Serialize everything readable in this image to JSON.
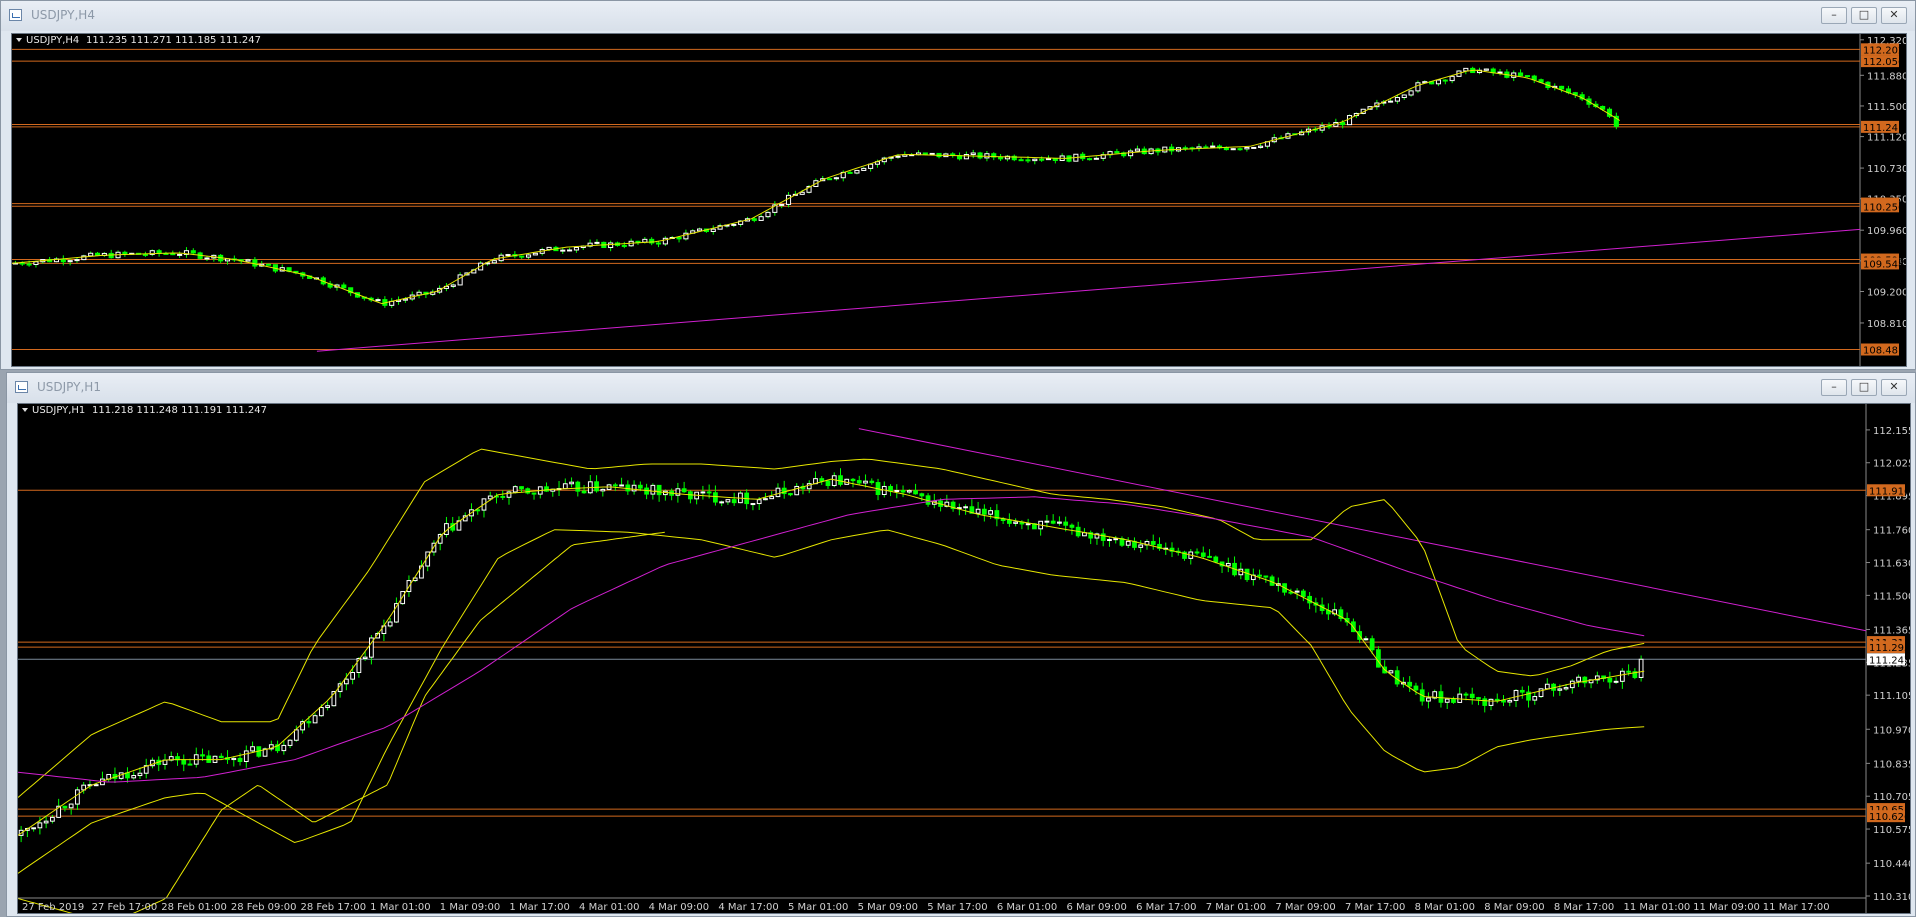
{
  "windows": [
    {
      "id": "top",
      "title": "USDJPY,H4",
      "symbol_label": "USDJPY,H4",
      "ohlc_label": "111.235 111.271 111.185 111.247",
      "buttons": [
        "–",
        "□",
        "✕"
      ],
      "chart_data": {
        "type": "candlestick",
        "price_axis": {
          "range": [
            108.45,
            112.33
          ],
          "ticks": [
            "112.320",
            "111.880",
            "111.500",
            "111.120",
            "110.730",
            "110.350",
            "109.960",
            "109.580",
            "109.200",
            "108.810"
          ],
          "tick_values": [
            112.32,
            111.88,
            111.5,
            111.12,
            110.73,
            110.35,
            109.96,
            109.58,
            109.2,
            108.81
          ]
        },
        "price_labels": [
          {
            "text": "112.202",
            "value": 112.202
          },
          {
            "text": "112.056",
            "value": 112.056
          },
          {
            "text": "111.241",
            "value": 111.241
          },
          {
            "text": "110.290",
            "value": 110.29
          },
          {
            "text": "110.256",
            "value": 110.256
          },
          {
            "text": "109.596",
            "value": 109.596
          },
          {
            "text": "109.548",
            "value": 109.548
          },
          {
            "text": "108.481",
            "value": 108.481
          }
        ],
        "horizontal_lines": [
          112.202,
          112.056,
          111.27,
          111.241,
          110.29,
          110.256,
          109.596,
          109.548,
          108.481
        ],
        "trendline": {
          "from": [
            0.165,
            108.46
          ],
          "to": [
            1.0,
            109.97
          ]
        },
        "series_path": [
          [
            0.0,
            109.55
          ],
          [
            0.05,
            109.65
          ],
          [
            0.09,
            109.68
          ],
          [
            0.12,
            109.6
          ],
          [
            0.16,
            109.4
          ],
          [
            0.2,
            109.05
          ],
          [
            0.23,
            109.2
          ],
          [
            0.26,
            109.6
          ],
          [
            0.3,
            109.75
          ],
          [
            0.35,
            109.82
          ],
          [
            0.4,
            110.1
          ],
          [
            0.44,
            110.6
          ],
          [
            0.48,
            110.9
          ],
          [
            0.52,
            110.88
          ],
          [
            0.57,
            110.85
          ],
          [
            0.62,
            110.95
          ],
          [
            0.67,
            111.0
          ],
          [
            0.72,
            111.3
          ],
          [
            0.76,
            111.75
          ],
          [
            0.79,
            111.95
          ],
          [
            0.82,
            111.85
          ],
          [
            0.85,
            111.6
          ],
          [
            0.87,
            111.32
          ]
        ],
        "last_price": 111.247
      }
    },
    {
      "id": "bottom",
      "title": "USDJPY,H1",
      "symbol_label": "USDJPY,H1",
      "ohlc_label": "111.218 111.248 111.191 111.247",
      "buttons": [
        "–",
        "□",
        "✕"
      ],
      "chart_data": {
        "type": "candlestick",
        "price_axis": {
          "range": [
            110.31,
            112.21
          ],
          "ticks": [
            "112.155",
            "112.025",
            "111.895",
            "111.760",
            "111.630",
            "111.500",
            "111.365",
            "111.235",
            "111.105",
            "110.970",
            "110.835",
            "110.705",
            "110.575",
            "110.440",
            "110.310"
          ],
          "tick_values": [
            112.155,
            112.025,
            111.895,
            111.76,
            111.63,
            111.5,
            111.365,
            111.235,
            111.105,
            110.97,
            110.835,
            110.705,
            110.575,
            110.44,
            110.31
          ]
        },
        "price_labels": [
          {
            "text": "111.916",
            "value": 111.916
          },
          {
            "text": "111.315",
            "value": 111.315
          },
          {
            "text": "111.295",
            "value": 111.295
          },
          {
            "text": "111.247",
            "value": 111.247
          },
          {
            "text": "110.654",
            "value": 110.654
          },
          {
            "text": "110.626",
            "value": 110.626
          }
        ],
        "horizontal_lines": [
          111.916,
          111.315,
          111.295,
          111.247,
          110.654,
          110.626
        ],
        "time_axis": [
          "27 Feb 2019",
          "27 Feb 17:00",
          "28 Feb 01:00",
          "28 Feb 09:00",
          "28 Feb 17:00",
          "1 Mar 01:00",
          "1 Mar 09:00",
          "1 Mar 17:00",
          "4 Mar 01:00",
          "4 Mar 09:00",
          "4 Mar 17:00",
          "5 Mar 01:00",
          "5 Mar 09:00",
          "5 Mar 17:00",
          "6 Mar 01:00",
          "6 Mar 09:00",
          "6 Mar 17:00",
          "7 Mar 01:00",
          "7 Mar 09:00",
          "7 Mar 17:00",
          "8 Mar 01:00",
          "8 Mar 09:00",
          "8 Mar 17:00",
          "11 Mar 01:00",
          "11 Mar 09:00",
          "11 Mar 17:00"
        ],
        "trendline": {
          "from": [
            0.455,
            112.16
          ],
          "to": [
            1.0,
            111.36
          ]
        },
        "ma_path": [
          [
            0.0,
            110.8
          ],
          [
            0.05,
            110.76
          ],
          [
            0.1,
            110.78
          ],
          [
            0.15,
            110.85
          ],
          [
            0.2,
            110.98
          ],
          [
            0.25,
            111.2
          ],
          [
            0.3,
            111.45
          ],
          [
            0.35,
            111.62
          ],
          [
            0.4,
            111.72
          ],
          [
            0.45,
            111.82
          ],
          [
            0.5,
            111.88
          ],
          [
            0.55,
            111.89
          ],
          [
            0.6,
            111.86
          ],
          [
            0.65,
            111.8
          ],
          [
            0.7,
            111.73
          ],
          [
            0.75,
            111.6
          ],
          [
            0.8,
            111.48
          ],
          [
            0.85,
            111.38
          ],
          [
            0.88,
            111.34
          ]
        ],
        "band_upper": [
          [
            0.0,
            110.7
          ],
          [
            0.04,
            110.95
          ],
          [
            0.08,
            111.08
          ],
          [
            0.11,
            111.0
          ],
          [
            0.14,
            111.0
          ],
          [
            0.16,
            111.3
          ],
          [
            0.19,
            111.6
          ],
          [
            0.22,
            111.95
          ],
          [
            0.25,
            112.08
          ],
          [
            0.28,
            112.04
          ],
          [
            0.31,
            112.0
          ],
          [
            0.34,
            112.02
          ],
          [
            0.37,
            112.02
          ],
          [
            0.41,
            112.0
          ],
          [
            0.44,
            112.03
          ],
          [
            0.46,
            112.04
          ],
          [
            0.5,
            112.0
          ],
          [
            0.53,
            111.95
          ],
          [
            0.56,
            111.9
          ],
          [
            0.59,
            111.88
          ],
          [
            0.62,
            111.85
          ],
          [
            0.65,
            111.8
          ],
          [
            0.67,
            111.72
          ],
          [
            0.7,
            111.72
          ],
          [
            0.72,
            111.85
          ],
          [
            0.74,
            111.88
          ],
          [
            0.76,
            111.7
          ],
          [
            0.78,
            111.3
          ],
          [
            0.8,
            111.2
          ],
          [
            0.82,
            111.18
          ],
          [
            0.84,
            111.22
          ],
          [
            0.86,
            111.28
          ],
          [
            0.88,
            111.31
          ]
        ],
        "band_mid": [
          [
            0.0,
            110.55
          ],
          [
            0.04,
            110.75
          ],
          [
            0.08,
            110.85
          ],
          [
            0.11,
            110.85
          ],
          [
            0.14,
            110.9
          ],
          [
            0.17,
            111.1
          ],
          [
            0.2,
            111.4
          ],
          [
            0.23,
            111.75
          ],
          [
            0.26,
            111.9
          ],
          [
            0.29,
            111.92
          ],
          [
            0.32,
            111.93
          ],
          [
            0.36,
            111.9
          ],
          [
            0.4,
            111.88
          ],
          [
            0.44,
            111.96
          ],
          [
            0.48,
            111.9
          ],
          [
            0.52,
            111.82
          ],
          [
            0.56,
            111.77
          ],
          [
            0.6,
            111.72
          ],
          [
            0.64,
            111.65
          ],
          [
            0.68,
            111.55
          ],
          [
            0.72,
            111.4
          ],
          [
            0.74,
            111.2
          ],
          [
            0.76,
            111.1
          ],
          [
            0.8,
            111.08
          ],
          [
            0.84,
            111.15
          ],
          [
            0.88,
            111.2
          ]
        ],
        "band_lower": [
          [
            0.0,
            110.4
          ],
          [
            0.04,
            110.6
          ],
          [
            0.08,
            110.7
          ],
          [
            0.1,
            110.72
          ],
          [
            0.13,
            110.6
          ],
          [
            0.15,
            110.52
          ],
          [
            0.18,
            110.6
          ],
          [
            0.2,
            110.9
          ],
          [
            0.23,
            111.3
          ],
          [
            0.26,
            111.65
          ],
          [
            0.29,
            111.76
          ],
          [
            0.33,
            111.75
          ],
          [
            0.37,
            111.72
          ],
          [
            0.41,
            111.65
          ],
          [
            0.44,
            111.72
          ],
          [
            0.47,
            111.76
          ],
          [
            0.5,
            111.7
          ],
          [
            0.53,
            111.62
          ],
          [
            0.56,
            111.58
          ],
          [
            0.6,
            111.55
          ],
          [
            0.64,
            111.48
          ],
          [
            0.68,
            111.45
          ],
          [
            0.7,
            111.3
          ],
          [
            0.72,
            111.05
          ],
          [
            0.74,
            110.88
          ],
          [
            0.76,
            110.8
          ],
          [
            0.78,
            110.82
          ],
          [
            0.8,
            110.9
          ],
          [
            0.82,
            110.93
          ],
          [
            0.84,
            110.95
          ],
          [
            0.86,
            110.97
          ],
          [
            0.88,
            110.98
          ]
        ],
        "band_outer_low": [
          [
            0.0,
            110.3
          ],
          [
            0.05,
            110.2
          ],
          [
            0.08,
            110.3
          ],
          [
            0.11,
            110.65
          ],
          [
            0.13,
            110.75
          ],
          [
            0.16,
            110.6
          ],
          [
            0.2,
            110.75
          ],
          [
            0.22,
            111.1
          ],
          [
            0.25,
            111.4
          ],
          [
            0.3,
            111.7
          ],
          [
            0.35,
            111.75
          ]
        ],
        "last_price": 111.247
      }
    }
  ],
  "colors": {
    "background": "#000000",
    "bull_candle": "#ffffff",
    "bear_candle": "#00ff00",
    "moving_average": "#e6e600",
    "trendline": "#d020d0",
    "level_line": "#d2691e",
    "price_tag": "#d2691e",
    "current_price_tag": "#ffffff"
  }
}
